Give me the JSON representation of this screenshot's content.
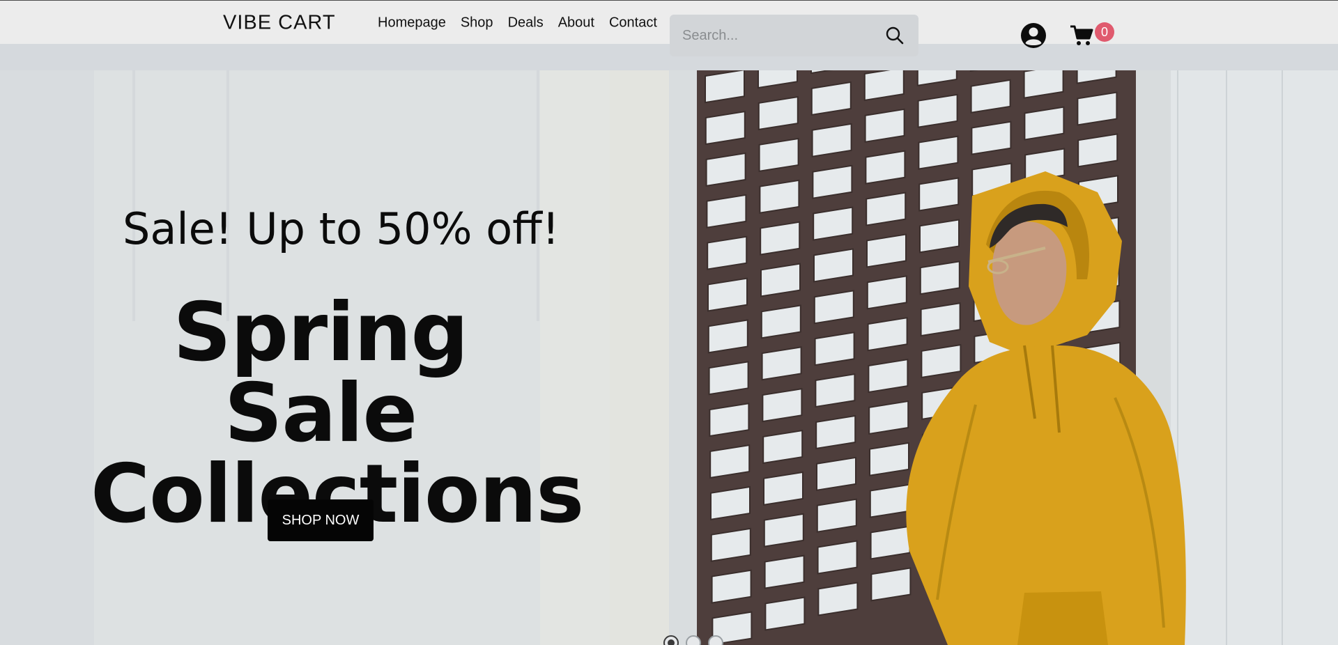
{
  "header": {
    "logo": "VIBE CART",
    "nav": [
      "Homepage",
      "Shop",
      "Deals",
      "About",
      "Contact"
    ],
    "search_placeholder": "Search...",
    "cart_count": "0"
  },
  "hero": {
    "sale_text": "Sale! Up to 50% off!",
    "headline_line1": "Spring Sale",
    "headline_line2": "Collections",
    "cta_label": "SHOP NOW",
    "image": "photo of a man in a yellow hoodie in front of an office building",
    "slides_total": 3,
    "active_slide": 1
  },
  "colors": {
    "header_bg": "#ececec",
    "hero_bg": "#d8dcdf",
    "cta_bg": "#050505",
    "badge": "#e05a6e",
    "hoodie": "#d9a11c"
  },
  "icons": [
    "search-icon",
    "user-icon",
    "cart-icon"
  ]
}
